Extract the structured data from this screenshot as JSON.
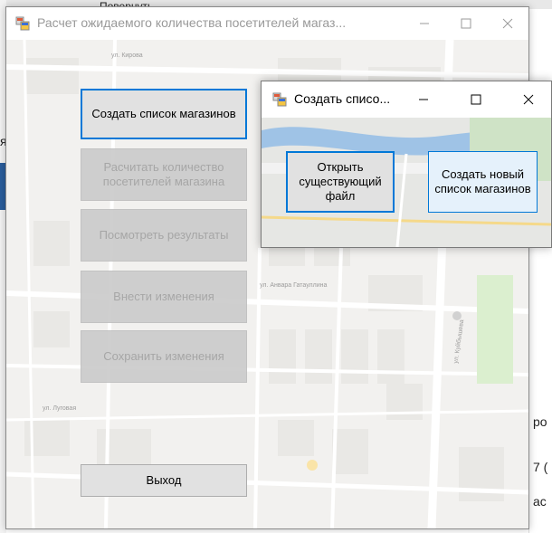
{
  "background": {
    "ribbon_label": "Повернуть",
    "left_text_1": "я",
    "right_text_1": "ро",
    "right_text_2": "7 (",
    "right_text_3": "ас"
  },
  "main_window": {
    "title": "Расчет ожидаемого количества посетителей магаз...",
    "buttons": {
      "create_list": "Создать список магазинов",
      "calculate": "Расчитать количество посетителей магазина",
      "view_results": "Посмотреть результаты",
      "edit": "Внести изменения",
      "save": "Сохранить изменения",
      "exit": "Выход"
    },
    "map_labels": {
      "street_1": "ул. Кирова",
      "street_2": "ул. Анвара Гатауллина",
      "street_3": "ул. Куйбышева",
      "street_4": "ул. Луговая"
    }
  },
  "dialog": {
    "title": "Создать списо...",
    "buttons": {
      "open_existing": "Открыть существующий файл",
      "create_new": "Создать новый список магазинов"
    }
  }
}
